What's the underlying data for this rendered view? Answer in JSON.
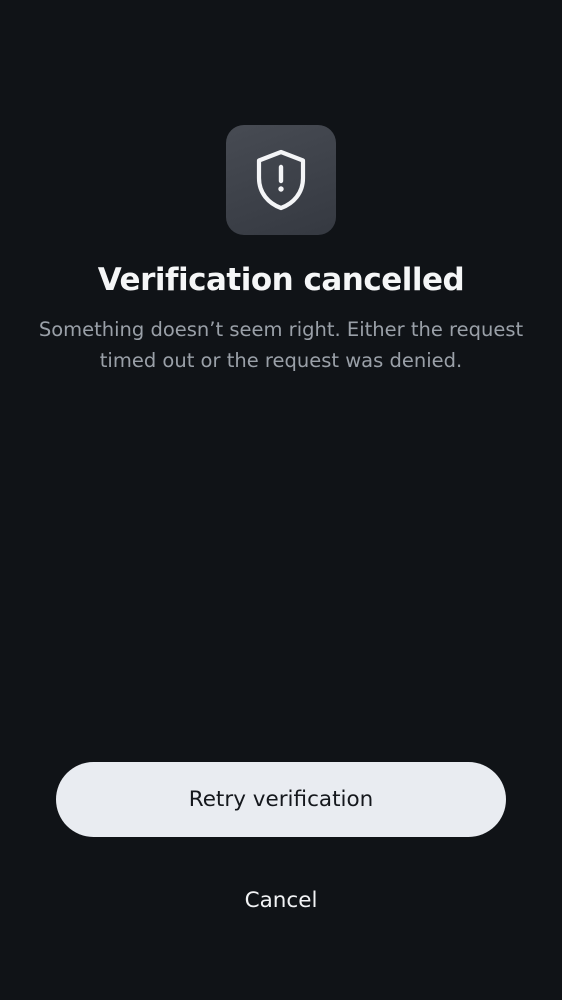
{
  "status": {
    "icon": "shield-alert-icon",
    "title": "Verification cancelled",
    "message": "Something doesn’t seem right. Either the request timed out or the request was denied."
  },
  "actions": {
    "retry_label": "Retry verification",
    "cancel_label": "Cancel"
  },
  "colors": {
    "background": "#101317",
    "icon_tile": "#3d4149",
    "primary_button": "#e9ecf1",
    "secondary_text": "#9aa0a8"
  }
}
